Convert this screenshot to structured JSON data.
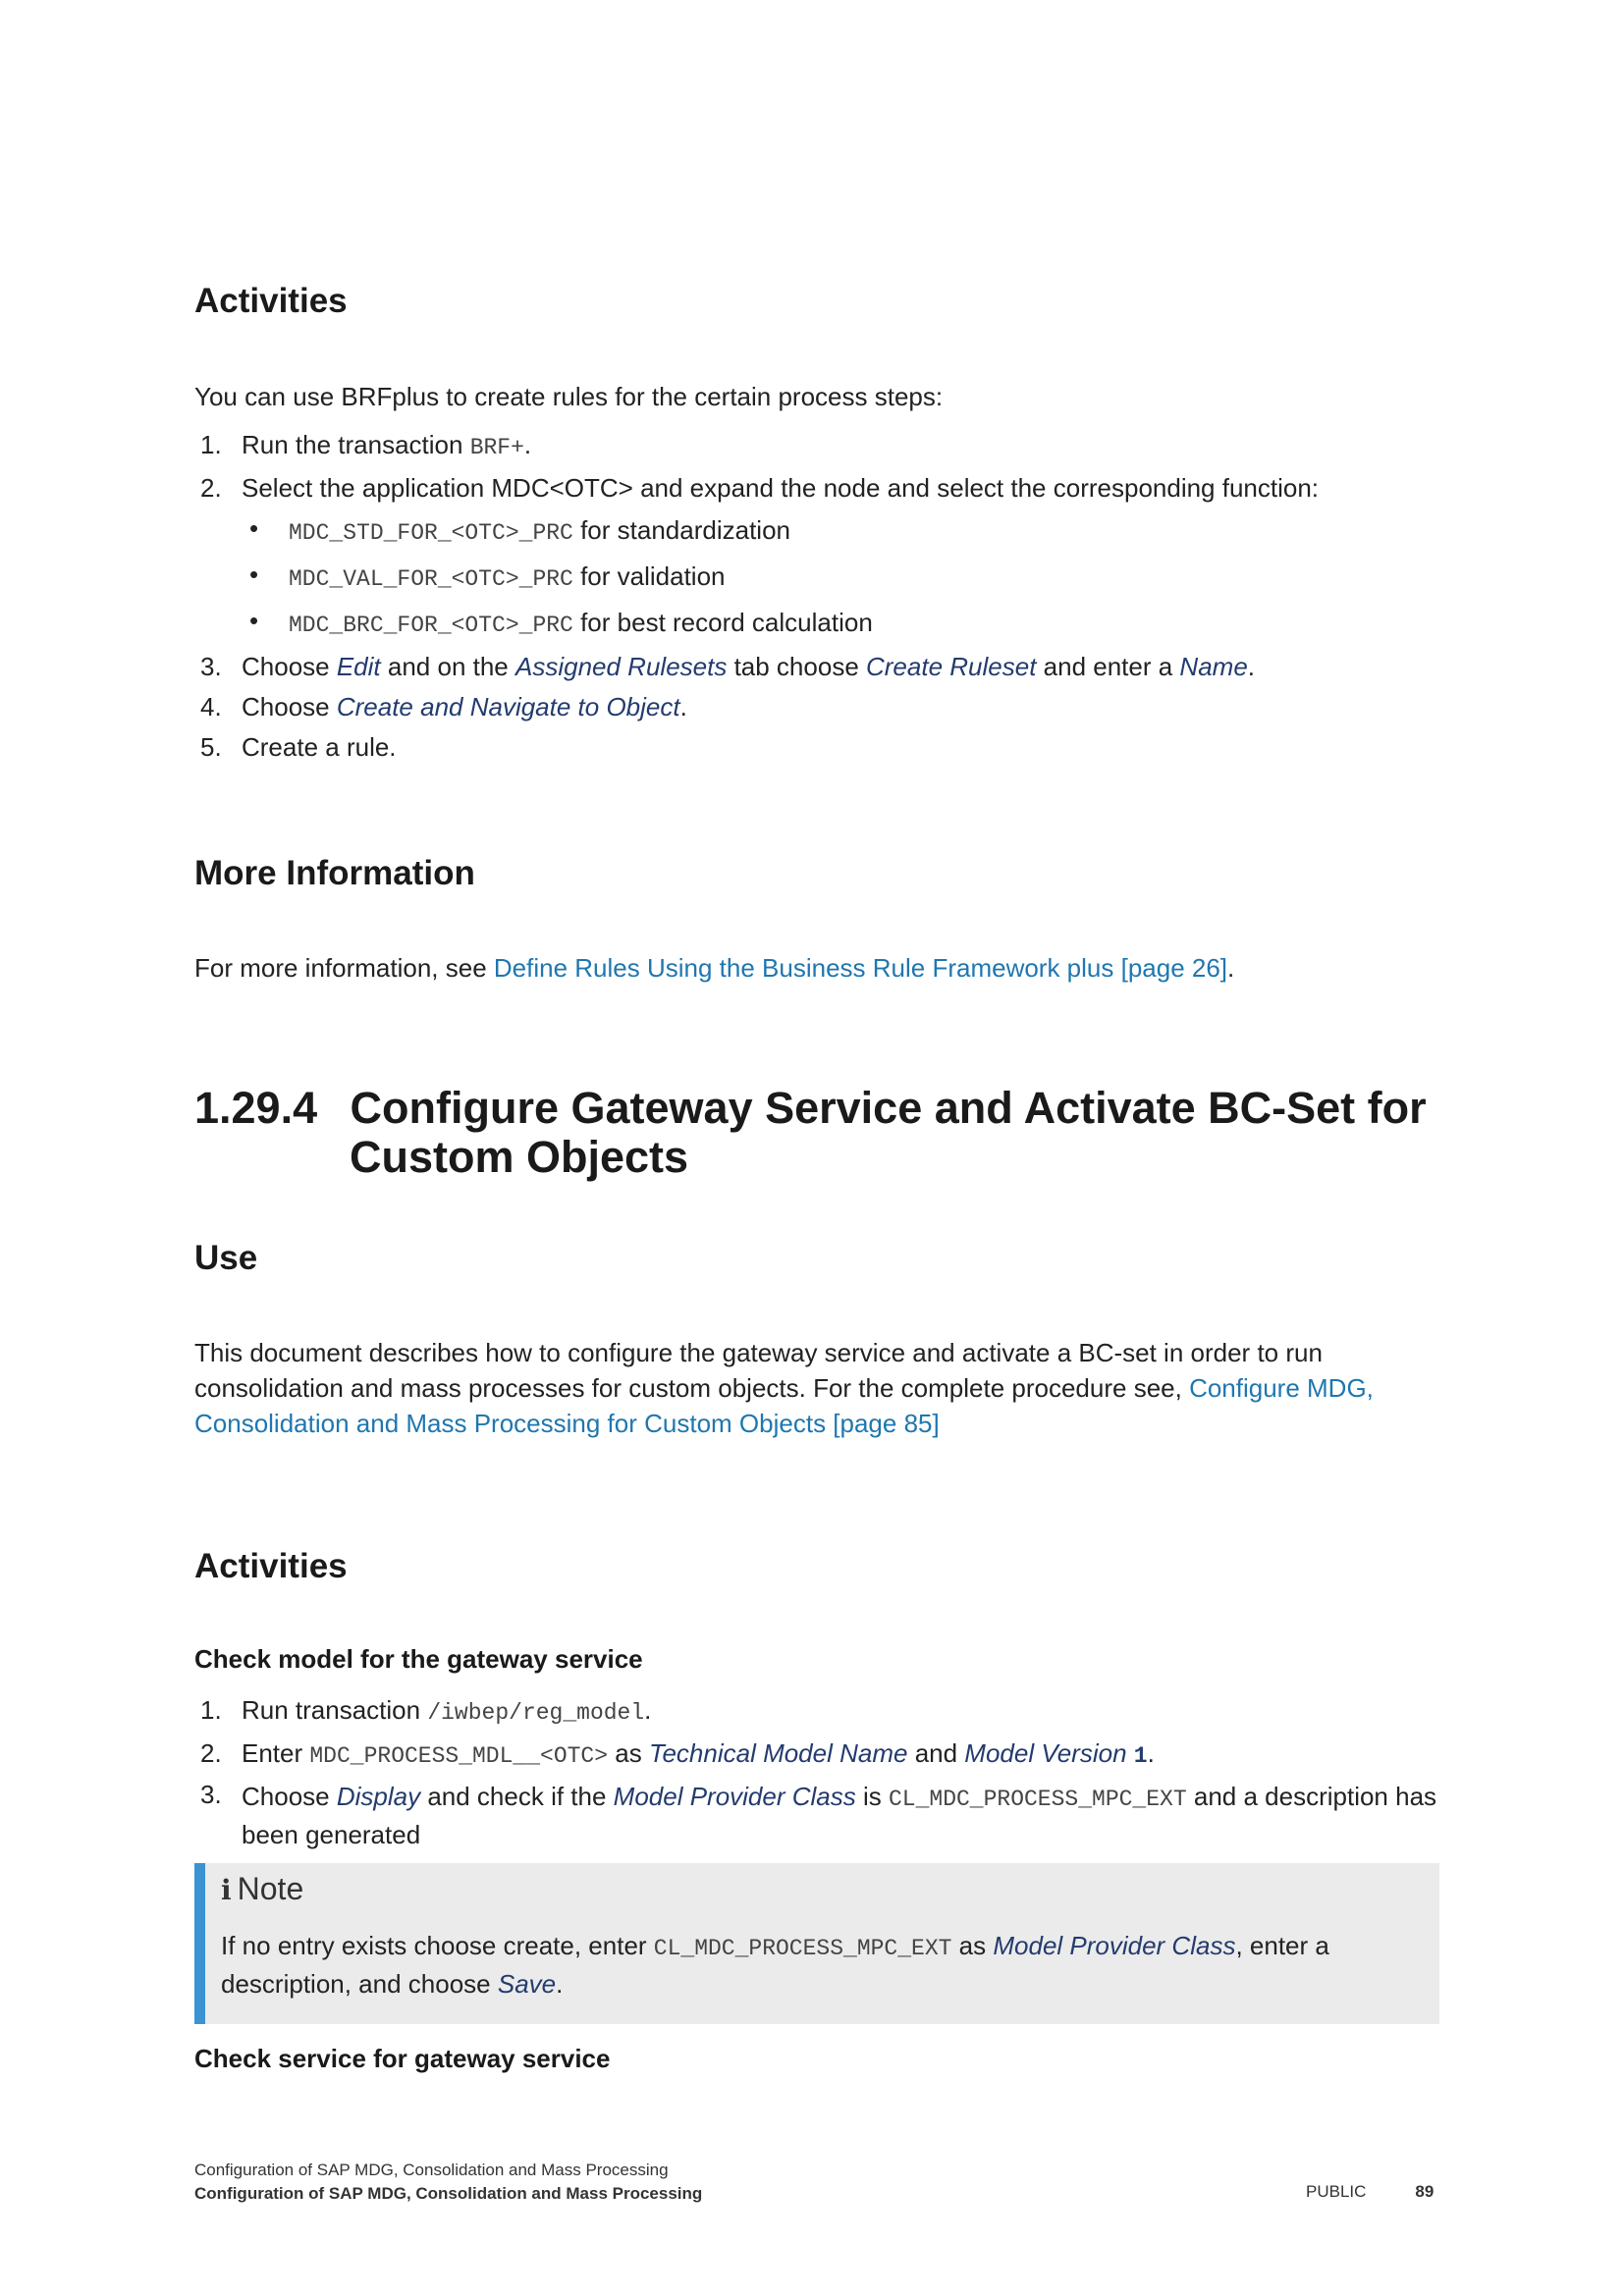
{
  "activities1": {
    "heading": "Activities",
    "intro": "You can use BRFplus to create rules for the certain process steps:",
    "step1_text": "Run the transaction ",
    "step1_code": "BRF+",
    "step2_text": "Select the application MDC<OTC> and expand the node and select the corresponding function:",
    "functions": [
      {
        "code": "MDC_STD_FOR_<OTC>_PRC",
        "desc": " for standardization"
      },
      {
        "code": "MDC_VAL_FOR_<OTC>_PRC",
        "desc": " for validation"
      },
      {
        "code": "MDC_BRC_FOR_<OTC>_PRC",
        "desc": " for best record calculation"
      }
    ],
    "step3_a": "Choose ",
    "step3_edit": "Edit",
    "step3_b": " and on the ",
    "step3_rulesets": "Assigned Rulesets",
    "step3_c": " tab choose ",
    "step3_create": "Create Ruleset",
    "step3_d": " and enter a ",
    "step3_name": "Name",
    "step4_a": "Choose ",
    "step4_link": "Create and Navigate to Object",
    "step5": "Create a rule."
  },
  "more_info": {
    "heading": "More Information",
    "text": "For more information, see ",
    "link": "Define Rules Using the Business Rule Framework plus [page 26]"
  },
  "section": {
    "number": "1.29.4",
    "title_line1": "Configure Gateway Service and Activate BC-Set for",
    "title_line2": "Custom Objects"
  },
  "use": {
    "heading": "Use",
    "text": "This document describes how to configure the gateway service and activate a BC-set in order to run consolidation and mass processes for custom objects. For the complete procedure see, ",
    "link": "Configure MDG, Consolidation and Mass Processing for Custom Objects [page 85]"
  },
  "activities2": {
    "heading": "Activities",
    "subheading": "Check model for the gateway service",
    "s1_text": "Run transaction ",
    "s1_code": "/iwbep/reg_model",
    "s2_a": "Enter ",
    "s2_code": "MDC_PROCESS_MDL__<OTC>",
    "s2_b": " as ",
    "s2_tmn": "Technical Model Name",
    "s2_c": " and ",
    "s2_mv": "Model Version",
    "s2_val": "1",
    "s3_a": "Choose ",
    "s3_display": "Display",
    "s3_b": " and check if the ",
    "s3_mpc": "Model Provider Class",
    "s3_c": " is ",
    "s3_code": "CL_MDC_PROCESS_MPC_EXT",
    "s3_d": " and a description has been generated"
  },
  "note": {
    "icon": "i",
    "title": "Note",
    "a": "If no entry exists choose create, enter ",
    "code": "CL_MDC_PROCESS_MPC_EXT",
    "b": " as ",
    "mpc": "Model Provider Class",
    "c": ", enter a description, and choose ",
    "save": "Save"
  },
  "check_service": "Check service for gateway service",
  "footer": {
    "line1": "Configuration of SAP MDG, Consolidation and Mass Processing",
    "line2": "Configuration of SAP MDG, Consolidation and Mass Processing",
    "classification": "PUBLIC",
    "page": "89"
  }
}
